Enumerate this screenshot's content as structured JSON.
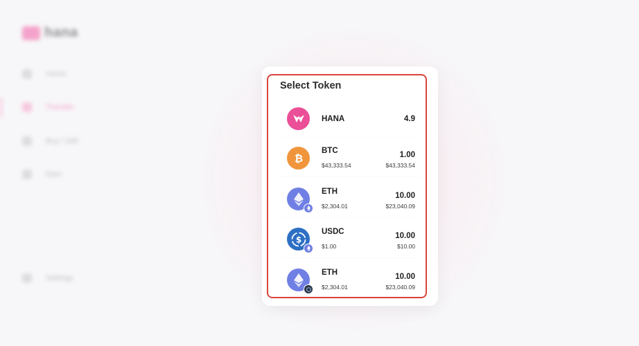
{
  "background": {
    "logo_text": "hana",
    "nav": [
      "Home",
      "Transfer",
      "Buy / Sell",
      "Earn",
      "Settings"
    ]
  },
  "modal": {
    "title": "Select Token",
    "tokens": [
      {
        "symbol": "HANA",
        "balance": "4.9",
        "price": "",
        "value": "",
        "icon": "hana-logo-icon",
        "color": "#ea4f98",
        "badge": ""
      },
      {
        "symbol": "BTC",
        "price": "$43,333.54",
        "balance": "1.00",
        "value": "$43,333.54",
        "icon": "bitcoin-icon",
        "color": "#f0953b",
        "badge": ""
      },
      {
        "symbol": "ETH",
        "price": "$2,304.01",
        "balance": "10.00",
        "value": "$23,040.09",
        "icon": "ethereum-icon",
        "color": "#6f7fe3",
        "badge": "ethereum-network-badge-icon"
      },
      {
        "symbol": "USDC",
        "price": "$1.00",
        "balance": "10.00",
        "value": "$10.00",
        "icon": "usdc-icon",
        "color": "#2d6fc4",
        "badge": "ethereum-network-badge-icon"
      },
      {
        "symbol": "ETH",
        "price": "$2,304.01",
        "balance": "10.00",
        "value": "$23,040.09",
        "icon": "ethereum-icon",
        "color": "#6f7fe3",
        "badge": "arbitrum-network-badge-icon"
      }
    ]
  },
  "colors": {
    "highlight": "#d9443a",
    "accent": "#f25fa6"
  }
}
